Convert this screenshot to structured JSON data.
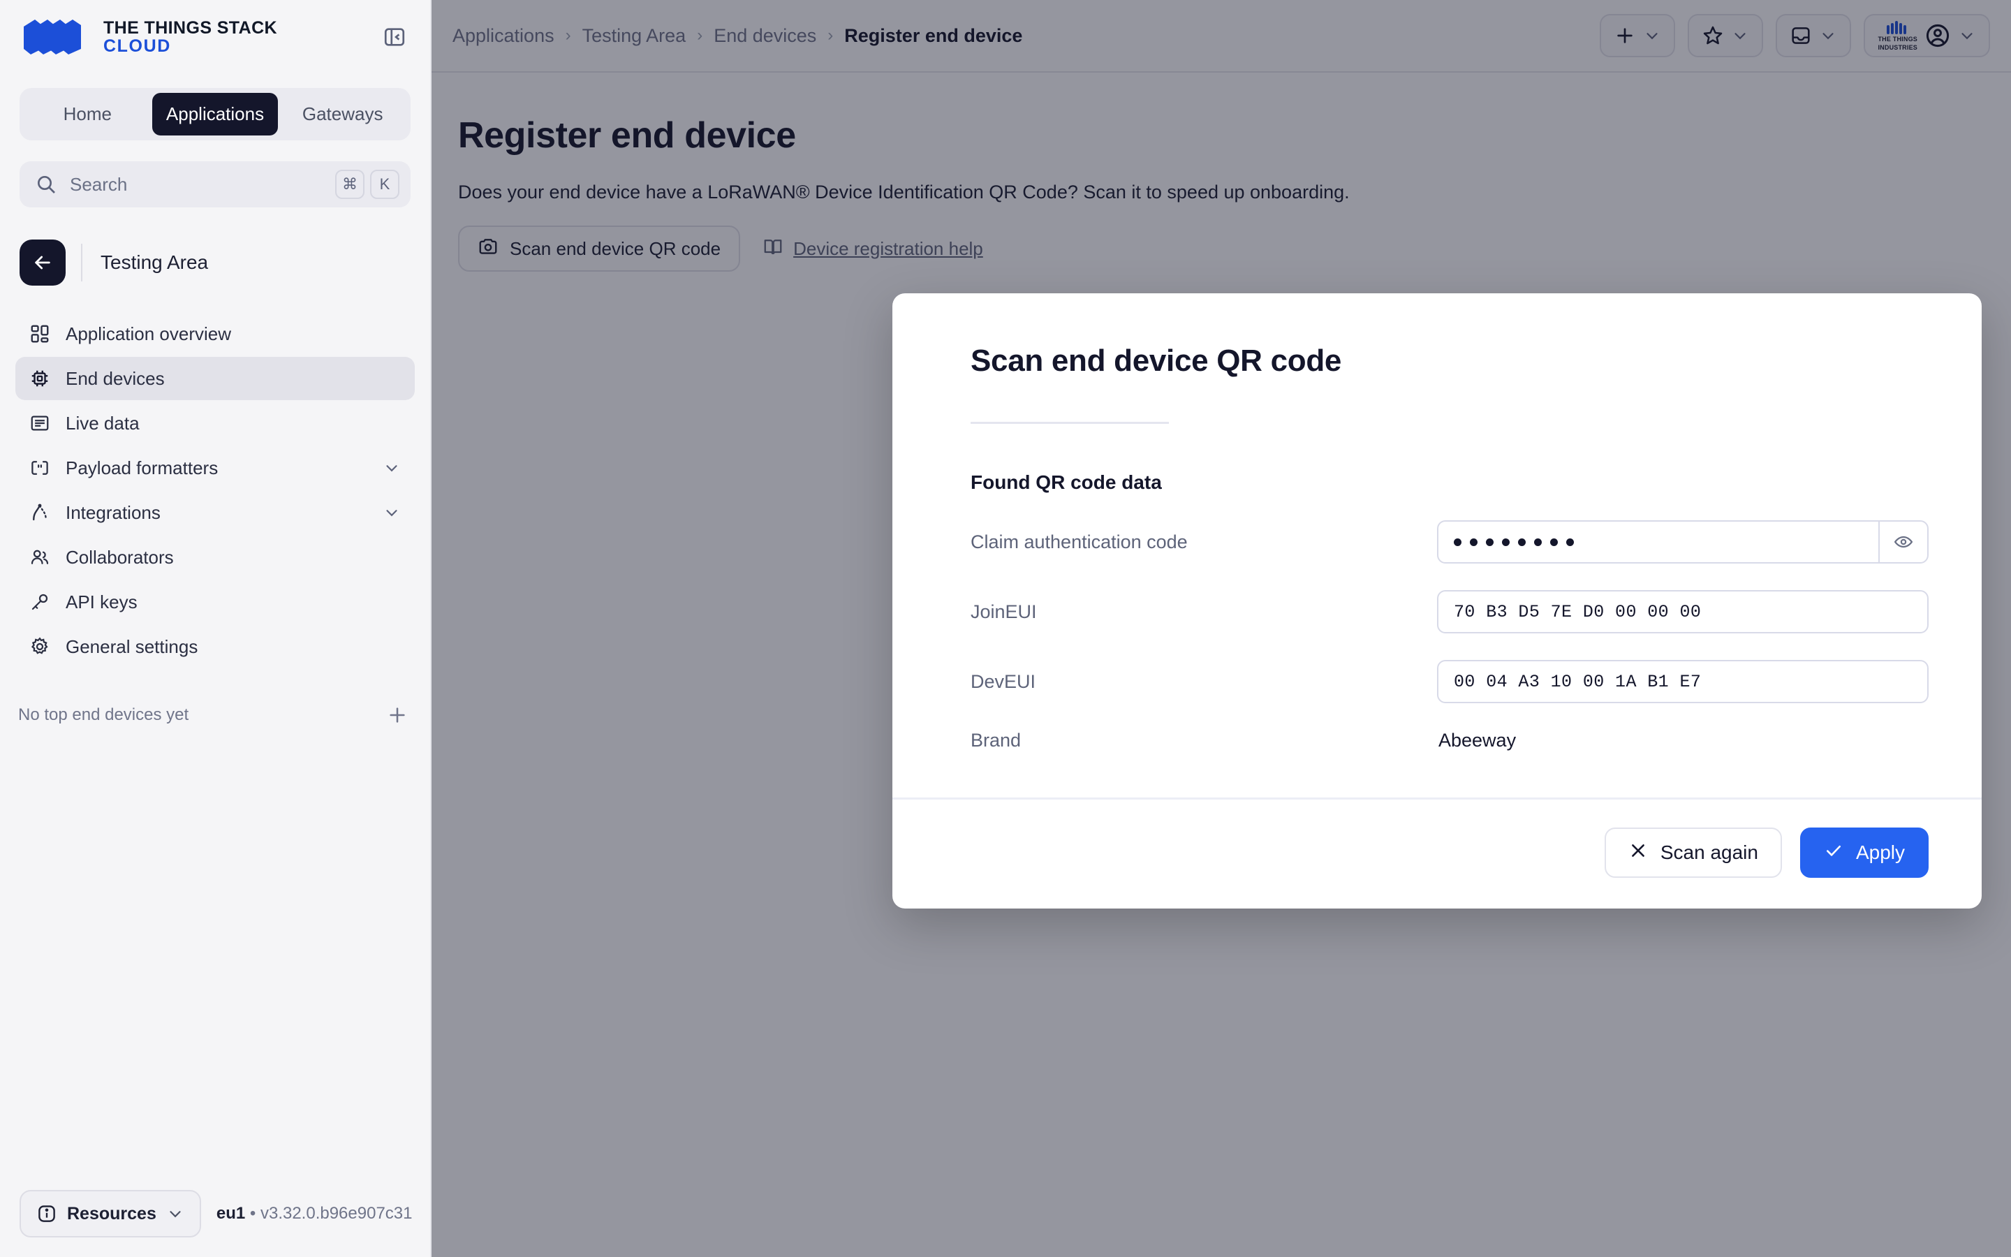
{
  "brand": {
    "line1": "THE THINGS STACK",
    "line2": "CLOUD",
    "accent": "#1c4fd8"
  },
  "sidebar": {
    "segments": [
      {
        "label": "Home",
        "active": false
      },
      {
        "label": "Applications",
        "active": true
      },
      {
        "label": "Gateways",
        "active": false
      }
    ],
    "search": {
      "placeholder": "Search",
      "kbd1": "⌘",
      "kbd2": "K"
    },
    "application_name": "Testing Area",
    "nav": [
      {
        "label": "Application overview",
        "icon": "grid-icon",
        "active": false,
        "expandable": false
      },
      {
        "label": "End devices",
        "icon": "chip-icon",
        "active": true,
        "expandable": false
      },
      {
        "label": "Live data",
        "icon": "list-icon",
        "active": false,
        "expandable": false
      },
      {
        "label": "Payload formatters",
        "icon": "code-brackets-icon",
        "active": false,
        "expandable": true
      },
      {
        "label": "Integrations",
        "icon": "integrations-icon",
        "active": false,
        "expandable": true
      },
      {
        "label": "Collaborators",
        "icon": "users-icon",
        "active": false,
        "expandable": false
      },
      {
        "label": "API keys",
        "icon": "key-icon",
        "active": false,
        "expandable": false
      },
      {
        "label": "General settings",
        "icon": "gear-icon",
        "active": false,
        "expandable": false
      }
    ],
    "empty_devices_text": "No top end devices yet",
    "footer": {
      "resources_label": "Resources",
      "cluster": "eu1",
      "separator": "•",
      "version": "v3.32.0.b96e907c31"
    }
  },
  "topbar": {
    "breadcrumbs": [
      {
        "label": "Applications",
        "current": false
      },
      {
        "label": "Testing Area",
        "current": false
      },
      {
        "label": "End devices",
        "current": false
      },
      {
        "label": "Register end device",
        "current": true
      }
    ],
    "separator": "›",
    "actions": [
      {
        "name": "add-button",
        "icon": "plus-icon"
      },
      {
        "name": "bookmarks-button",
        "icon": "star-icon"
      },
      {
        "name": "notifications-button",
        "icon": "inbox-icon"
      },
      {
        "name": "account-button",
        "icon": "user-circle-icon"
      }
    ],
    "tti_logo_line1": "THE THINGS",
    "tti_logo_line2": "INDUSTRIES"
  },
  "page": {
    "title": "Register end device",
    "description": "Does your end device have a LoRaWAN® Device Identification QR Code? Scan it to speed up onboarding.",
    "scan_button": "Scan end device QR code",
    "help_link": "Device registration help"
  },
  "modal": {
    "title": "Scan end device QR code",
    "section_title": "Found QR code data",
    "fields": [
      {
        "label": "Claim authentication code",
        "type": "password",
        "masked_length": 8,
        "has_reveal": true,
        "reveal_icon": "eye-icon"
      },
      {
        "label": "JoinEUI",
        "type": "text",
        "value": "70 B3 D5 7E D0 00 00 00"
      },
      {
        "label": "DevEUI",
        "type": "text",
        "value": "00 04 A3 10 00 1A B1 E7"
      },
      {
        "label": "Brand",
        "type": "static",
        "value": "Abeeway"
      }
    ],
    "secondary_button": "Scan again",
    "primary_button": "Apply",
    "primary_color": "#2663f0"
  }
}
